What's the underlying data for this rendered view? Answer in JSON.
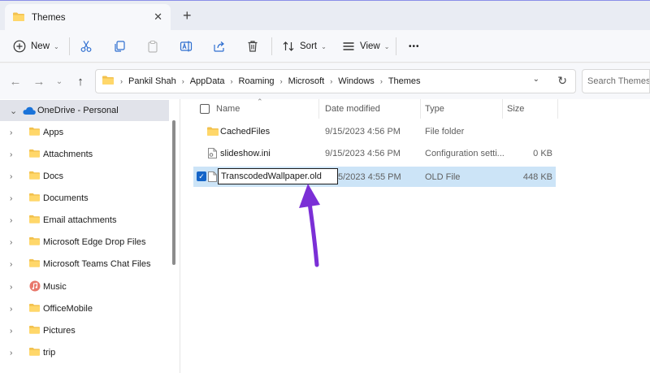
{
  "window": {
    "tab_title": "Themes",
    "close_glyph": "✕",
    "new_tab_glyph": "+"
  },
  "toolbar": {
    "new_label": "New",
    "sort_label": "Sort",
    "view_label": "View",
    "more_glyph": "•••"
  },
  "address": {
    "breadcrumbs": [
      "Pankil Shah",
      "AppData",
      "Roaming",
      "Microsoft",
      "Windows",
      "Themes"
    ],
    "search_placeholder": "Search Themes"
  },
  "sidebar": {
    "items": [
      {
        "label": "OneDrive - Personal",
        "icon": "cloud-icon",
        "expanded": true
      },
      {
        "label": "Apps",
        "icon": "folder-icon"
      },
      {
        "label": "Attachments",
        "icon": "folder-icon"
      },
      {
        "label": "Docs",
        "icon": "folder-icon"
      },
      {
        "label": "Documents",
        "icon": "folder-icon"
      },
      {
        "label": "Email attachments",
        "icon": "folder-icon"
      },
      {
        "label": "Microsoft Edge Drop Files",
        "icon": "folder-icon"
      },
      {
        "label": "Microsoft Teams Chat Files",
        "icon": "folder-icon"
      },
      {
        "label": "Music",
        "icon": "music-icon"
      },
      {
        "label": "OfficeMobile",
        "icon": "folder-icon"
      },
      {
        "label": "Pictures",
        "icon": "folder-icon"
      },
      {
        "label": "trip",
        "icon": "folder-icon"
      }
    ]
  },
  "files": {
    "columns": [
      "Name",
      "Date modified",
      "Type",
      "Size"
    ],
    "rows": [
      {
        "name": "CachedFiles",
        "date": "9/15/2023 4:56 PM",
        "type": "File folder",
        "size": "",
        "icon": "folder-icon"
      },
      {
        "name": "slideshow.ini",
        "date": "9/15/2023 4:56 PM",
        "type": "Configuration setti...",
        "size": "0 KB",
        "icon": "ini-file-icon"
      },
      {
        "name": "TranscodedWallpaper.old",
        "date": "5/2023 4:55 PM",
        "type": "OLD File",
        "size": "448 KB",
        "icon": "file-icon",
        "selected": true,
        "renaming": true
      }
    ]
  },
  "colors": {
    "accent": "#1464c8",
    "selection": "#cce4f7",
    "annotation_arrow": "#7b2fd6",
    "folder": "#f2c14e"
  }
}
